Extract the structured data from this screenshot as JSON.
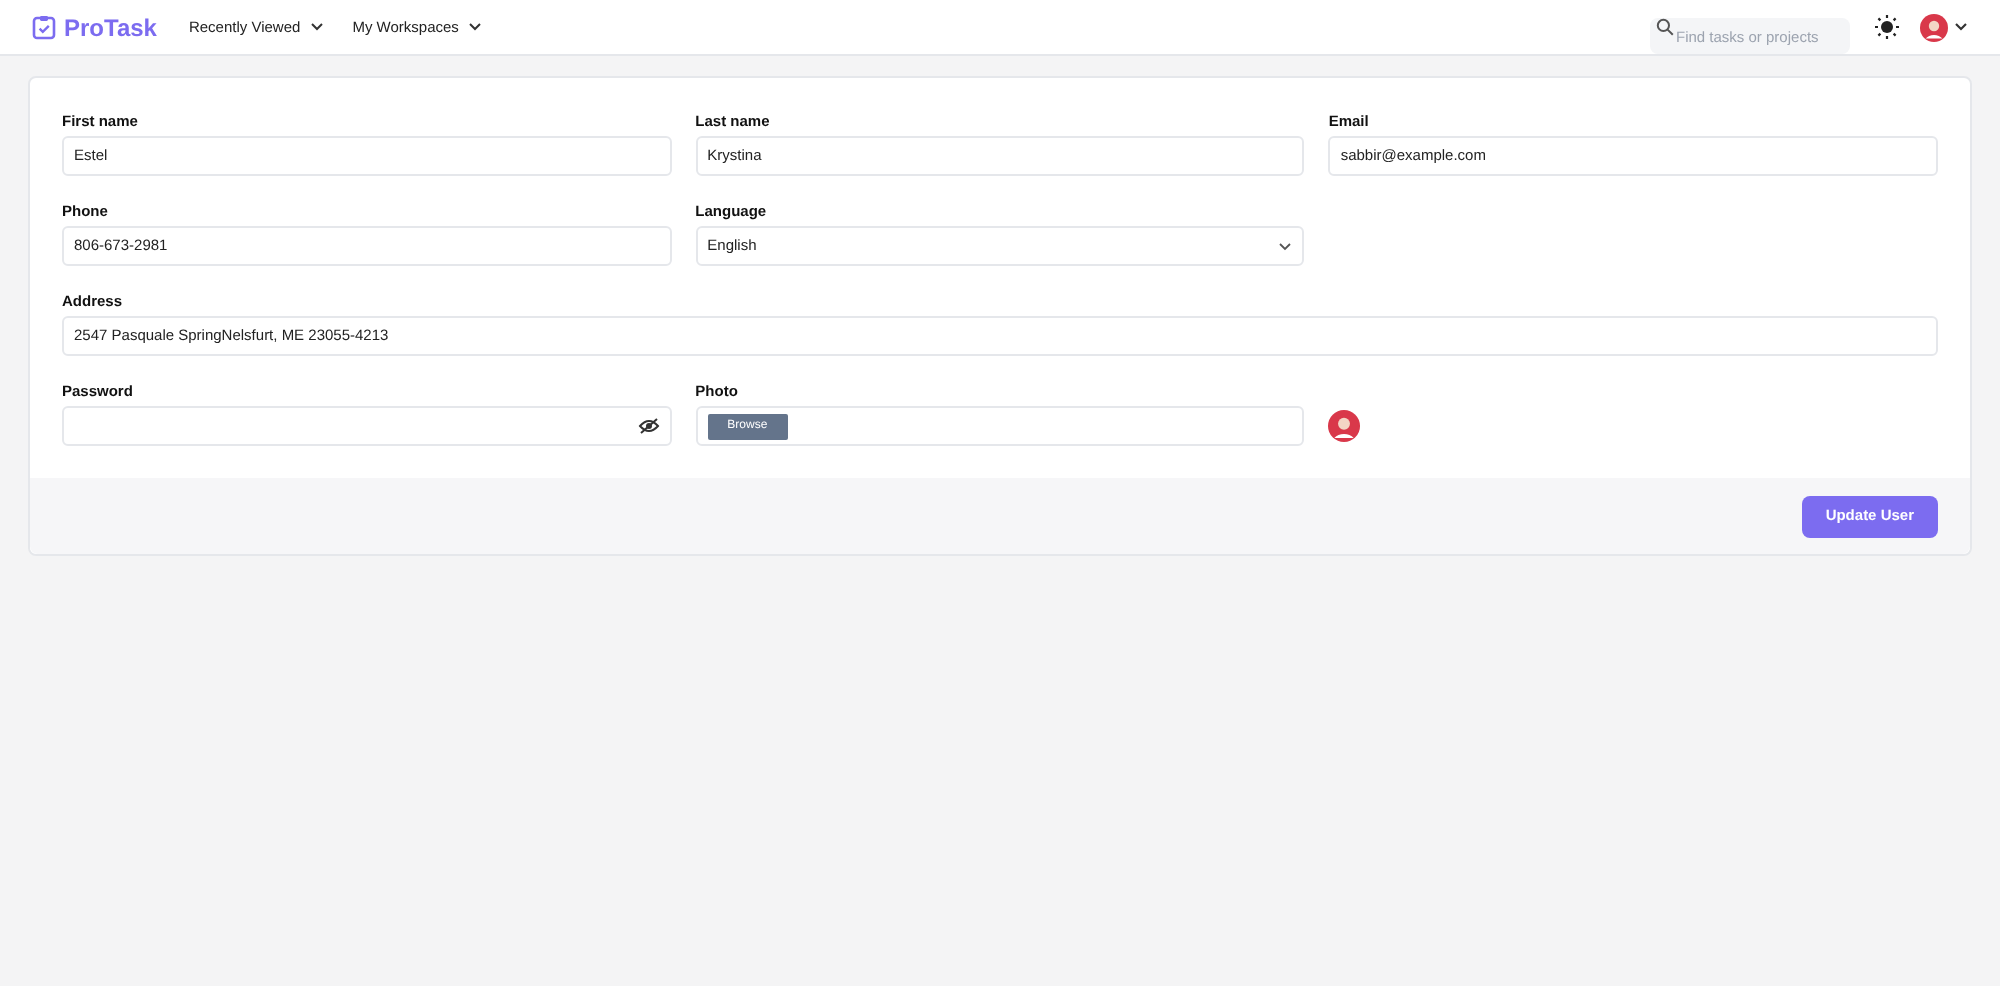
{
  "header": {
    "logo": "ProTask",
    "nav": [
      "Recently Viewed",
      "My Workspaces"
    ],
    "search": {
      "placeholder": "Find tasks or projects"
    }
  },
  "form": {
    "fields": [
      {
        "kind": "text",
        "label": "First name",
        "value": "Estel"
      },
      {
        "kind": "text",
        "label": "Last name",
        "value": "Krystina"
      },
      {
        "kind": "text",
        "label": "Email",
        "value": "sabbir@example.com"
      },
      {
        "kind": "text",
        "label": "Phone",
        "value": "806-673-2981"
      },
      {
        "kind": "select",
        "label": "Language",
        "value": "English"
      },
      {
        "kind": "wide",
        "label": "Address",
        "value": "2547 Pasquale SpringNelsfurt, ME 23055-4213"
      },
      {
        "kind": "password",
        "label": "Password"
      },
      {
        "kind": "file",
        "label": "Photo",
        "button": "Browse"
      }
    ],
    "submit": "Update User"
  }
}
